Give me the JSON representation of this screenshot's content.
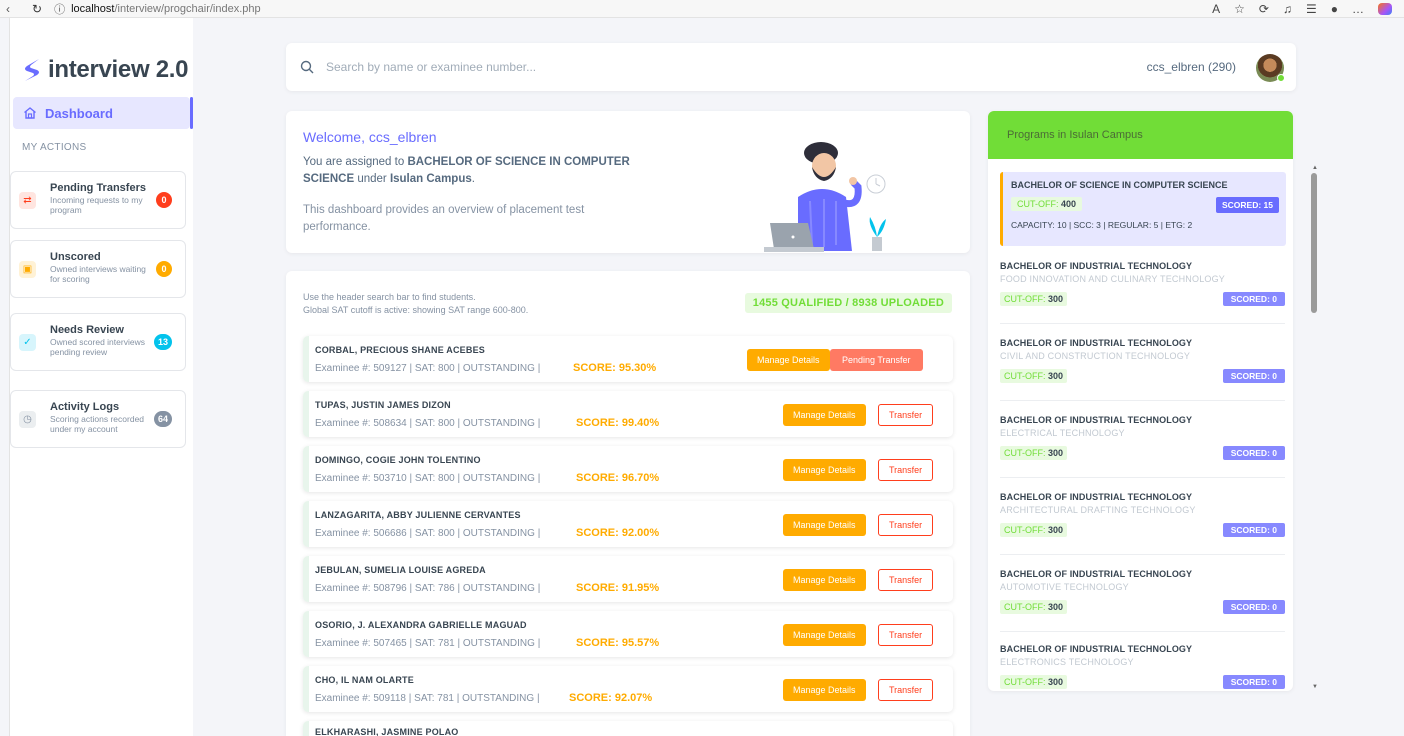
{
  "browser": {
    "url_host": "localhost",
    "url_path": "/interview/progchair/index.php"
  },
  "brand": {
    "name": "interview 2.0"
  },
  "sidebar": {
    "dashboard_label": "Dashboard",
    "section_label": "MY ACTIONS",
    "actions": [
      {
        "title": "Pending Transfers",
        "desc": "Incoming requests to my program",
        "count": "0",
        "color": "#ff3e1d",
        "bg": "#ffe5e0",
        "icon": "swap-icon"
      },
      {
        "title": "Unscored",
        "desc": "Owned interviews waiting for scoring",
        "count": "0",
        "color": "#ffab00",
        "bg": "#fff2d6",
        "icon": "calendar-icon"
      },
      {
        "title": "Needs Review",
        "desc": "Owned scored interviews pending review",
        "count": "13",
        "color": "#03c3ec",
        "bg": "#d7f5fc",
        "icon": "check-circle-icon"
      },
      {
        "title": "Activity Logs",
        "desc": "Scoring actions recorded under my account",
        "count": "64",
        "color": "#8592a3",
        "bg": "#ebeef0",
        "icon": "history-icon"
      }
    ]
  },
  "header": {
    "search_placeholder": "Search by name or examinee number...",
    "username": "ccs_elbren (290)"
  },
  "welcome": {
    "title": "Welcome, ccs_elbren",
    "assigned_prefix": "You are assigned to ",
    "program": "BACHELOR OF SCIENCE IN COMPUTER SCIENCE",
    "under": " under ",
    "campus": "Isulan Campus",
    "period": ".",
    "description": "This dashboard provides an overview of placement test performance."
  },
  "students": {
    "hint_line1": "Use the header search bar to find students.",
    "hint_line2": "Global SAT cutoff is active: showing SAT range 600-800.",
    "stat": "1455 QUALIFIED / 8938 UPLOADED",
    "manage_label": "Manage Details",
    "transfer_label": "Transfer",
    "pending_label": "Pending Transfer",
    "rows": [
      {
        "name": "CORBAL, PRECIOUS SHANE ACEBES",
        "meta": "Examinee #: 509127  |  SAT: 800  |  OUTSTANDING  |",
        "score": "SCORE: 95.30%"
      },
      {
        "name": "TUPAS, JUSTIN JAMES DIZON",
        "meta": "Examinee #: 508634  |  SAT: 800  |  OUTSTANDING  |",
        "score": "SCORE: 99.40%"
      },
      {
        "name": "DOMINGO, COGIE JOHN TOLENTINO",
        "meta": "Examinee #: 503710  |  SAT: 800  |  OUTSTANDING  |",
        "score": "SCORE: 96.70%"
      },
      {
        "name": "LANZAGARITA, ABBY JULIENNE CERVANTES",
        "meta": "Examinee #: 506686  |  SAT: 800  |  OUTSTANDING  |",
        "score": "SCORE: 92.00%"
      },
      {
        "name": "JEBULAN, SUMELIA LOUISE AGREDA",
        "meta": "Examinee #: 508796  |  SAT: 786  |  OUTSTANDING  |",
        "score": "SCORE: 91.95%"
      },
      {
        "name": "OSORIO, J. ALEXANDRA GABRIELLE MAGUAD",
        "meta": "Examinee #: 507465  |  SAT: 781  |  OUTSTANDING  |",
        "score": "SCORE: 95.57%"
      },
      {
        "name": "CHO, IL NAM OLARTE",
        "meta": "Examinee #: 509118  |  SAT: 781  |  OUTSTANDING  |",
        "score": "SCORE: 92.07%"
      },
      {
        "name": "ELKHARASHI, JASMINE POLAO",
        "meta": "",
        "score": ""
      }
    ]
  },
  "programs": {
    "title": "Programs in Isulan Campus",
    "cutoff_label": "CUT-OFF: ",
    "active": {
      "title": "BACHELOR OF SCIENCE IN COMPUTER SCIENCE",
      "cutoff": "400",
      "scored": "SCORED: 15",
      "capacity": "CAPACITY: 10 | SCC: 3 | REGULAR: 5 | ETG: 2"
    },
    "items": [
      {
        "title": "BACHELOR OF INDUSTRIAL TECHNOLOGY",
        "major": "FOOD INNOVATION AND CULINARY TECHNOLOGY",
        "cutoff": "300",
        "scored": "SCORED: 0"
      },
      {
        "title": "BACHELOR OF INDUSTRIAL TECHNOLOGY",
        "major": "CIVIL AND CONSTRUCTION TECHNOLOGY",
        "cutoff": "300",
        "scored": "SCORED: 0"
      },
      {
        "title": "BACHELOR OF INDUSTRIAL TECHNOLOGY",
        "major": "ELECTRICAL TECHNOLOGY",
        "cutoff": "300",
        "scored": "SCORED: 0"
      },
      {
        "title": "BACHELOR OF INDUSTRIAL TECHNOLOGY",
        "major": "ARCHITECTURAL DRAFTING TECHNOLOGY",
        "cutoff": "300",
        "scored": "SCORED: 0"
      },
      {
        "title": "BACHELOR OF INDUSTRIAL TECHNOLOGY",
        "major": "AUTOMOTIVE TECHNOLOGY",
        "cutoff": "300",
        "scored": "SCORED: 0"
      },
      {
        "title": "BACHELOR OF INDUSTRIAL TECHNOLOGY",
        "major": "ELECTRONICS TECHNOLOGY",
        "cutoff": "300",
        "scored": "SCORED: 0"
      }
    ]
  }
}
